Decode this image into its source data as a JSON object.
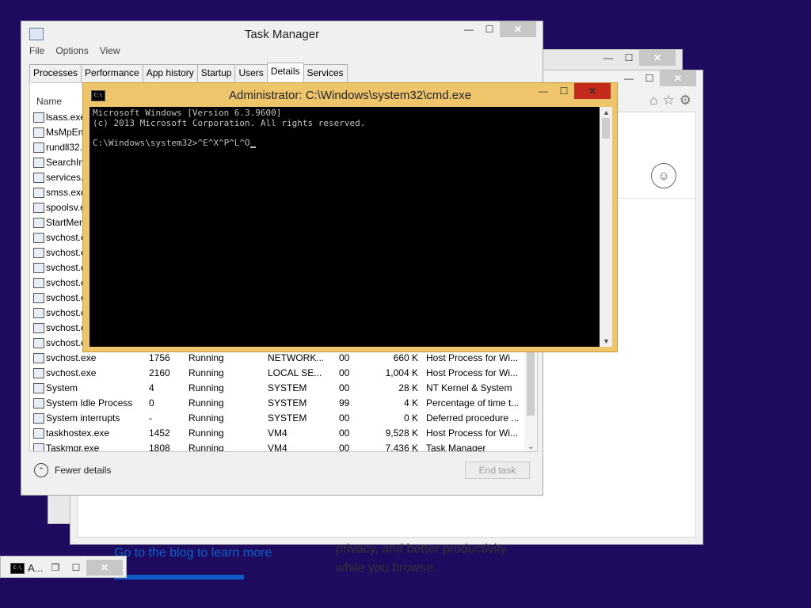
{
  "bg_browser": {
    "link": "Go to the blog to learn more",
    "privacy_line1": "privacy, and better productivity",
    "privacy_line2": "while you browse.",
    "icons": [
      "home-icon",
      "star-icon",
      "gear-icon",
      "user-icon"
    ]
  },
  "taskmgr": {
    "title": "Task Manager",
    "menu": [
      "File",
      "Options",
      "View"
    ],
    "tabs": [
      "Processes",
      "Performance",
      "App history",
      "Startup",
      "Users",
      "Details",
      "Services"
    ],
    "active_tab": "Details",
    "column_name": "Name",
    "rows_top": [
      "lsass.exe",
      "MsMpEn",
      "rundll32.",
      "SearchInd",
      "services.e",
      "smss.exe",
      "spoolsv.e",
      "StartMen",
      "svchost.e",
      "svchost.e",
      "svchost.e",
      "svchost.e",
      "svchost.e",
      "svchost.e",
      "svchost.e",
      "svchost.e"
    ],
    "rows_full": [
      {
        "name": "svchost.exe",
        "pid": "1756",
        "status": "Running",
        "user": "NETWORK...",
        "cpu": "00",
        "mem": "660 K",
        "desc": "Host Process for Wi..."
      },
      {
        "name": "svchost.exe",
        "pid": "2160",
        "status": "Running",
        "user": "LOCAL SE...",
        "cpu": "00",
        "mem": "1,004 K",
        "desc": "Host Process for Wi..."
      },
      {
        "name": "System",
        "pid": "4",
        "status": "Running",
        "user": "SYSTEM",
        "cpu": "00",
        "mem": "28 K",
        "desc": "NT Kernel & System"
      },
      {
        "name": "System Idle Process",
        "pid": "0",
        "status": "Running",
        "user": "SYSTEM",
        "cpu": "99",
        "mem": "4 K",
        "desc": "Percentage of time t..."
      },
      {
        "name": "System interrupts",
        "pid": "-",
        "status": "Running",
        "user": "SYSTEM",
        "cpu": "00",
        "mem": "0 K",
        "desc": "Deferred procedure ..."
      },
      {
        "name": "taskhostex.exe",
        "pid": "1452",
        "status": "Running",
        "user": "VM4",
        "cpu": "00",
        "mem": "9,528 K",
        "desc": "Host Process for Wi..."
      },
      {
        "name": "Taskmgr.exe",
        "pid": "1808",
        "status": "Running",
        "user": "VM4",
        "cpu": "00",
        "mem": "7,436 K",
        "desc": "Task Manager"
      }
    ],
    "fewer_details": "Fewer details",
    "end_task": "End task"
  },
  "cmd": {
    "title": "Administrator: C:\\Windows\\system32\\cmd.exe",
    "lines": [
      "Microsoft Windows [Version 6.3.9600]",
      "(c) 2013 Microsoft Corporation. All rights reserved.",
      "",
      "C:\\Windows\\system32>^E^X^P^L^O"
    ],
    "icon_label": "C:\\"
  },
  "minimized": {
    "title": "A..."
  },
  "caption": {
    "minimize": "—",
    "maximize": "☐",
    "close": "✕"
  }
}
